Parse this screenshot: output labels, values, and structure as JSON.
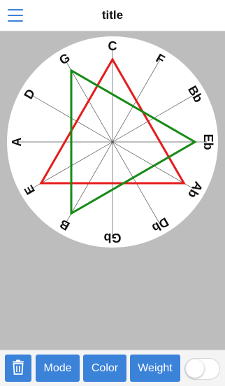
{
  "nav": {
    "title": "title",
    "menu_icon": "hamburger-menu-icon"
  },
  "wheel": {
    "background": "#ffffff",
    "line_color": "#555555",
    "notes": [
      {
        "name": "C",
        "rotation": 0
      },
      {
        "name": "F",
        "rotation": 30
      },
      {
        "name": "Bb",
        "rotation": 60
      },
      {
        "name": "Eb",
        "rotation": 90
      },
      {
        "name": "Ab",
        "rotation": 120
      },
      {
        "name": "Db",
        "rotation": 150
      },
      {
        "name": "Gb",
        "rotation": 180
      },
      {
        "name": "B",
        "rotation": 210
      },
      {
        "name": "E",
        "rotation": 240
      },
      {
        "name": "A",
        "rotation": 270
      },
      {
        "name": "D",
        "rotation": 300
      },
      {
        "name": "G",
        "rotation": 330
      }
    ],
    "triads": [
      {
        "color": "#e51c1c",
        "notes": [
          "C",
          "Ab",
          "E"
        ]
      },
      {
        "color": "#168b16",
        "notes": [
          "G",
          "Eb",
          "B"
        ]
      }
    ]
  },
  "toolbar": {
    "trash_icon": "trash-icon",
    "mode_label": "Mode",
    "color_label": "Color",
    "weight_label": "Weight",
    "toggle_on": false,
    "accent": "#3b82d9"
  }
}
